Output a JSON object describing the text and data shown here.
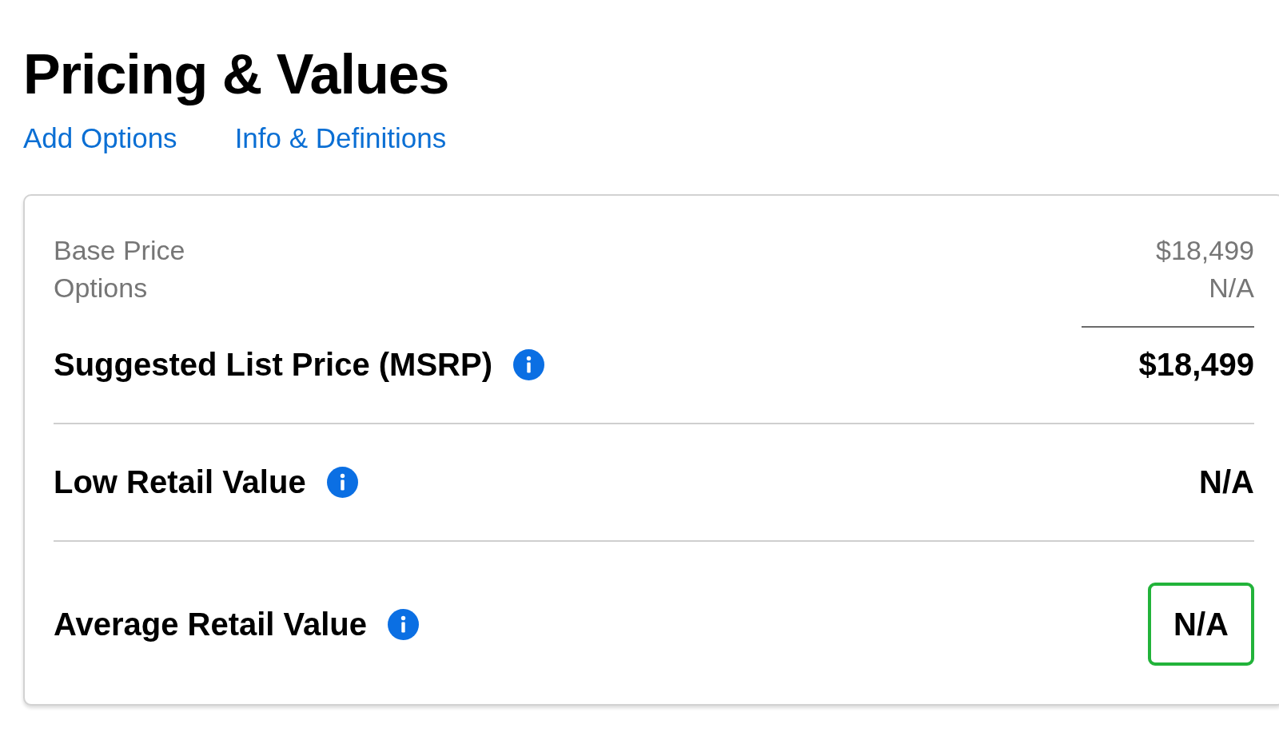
{
  "title": "Pricing & Values",
  "links": [
    "Add Options",
    "Info & Definitions"
  ],
  "breakdown": [
    {
      "label": "Base Price",
      "value": "$18,499"
    },
    {
      "label": "Options",
      "value": "N/A"
    }
  ],
  "values": [
    {
      "label": "Suggested List Price (MSRP)",
      "value": "$18,499",
      "highlighted": false
    },
    {
      "label": "Low Retail Value",
      "value": "N/A",
      "highlighted": false
    },
    {
      "label": "Average Retail Value",
      "value": "N/A",
      "highlighted": true
    }
  ]
}
